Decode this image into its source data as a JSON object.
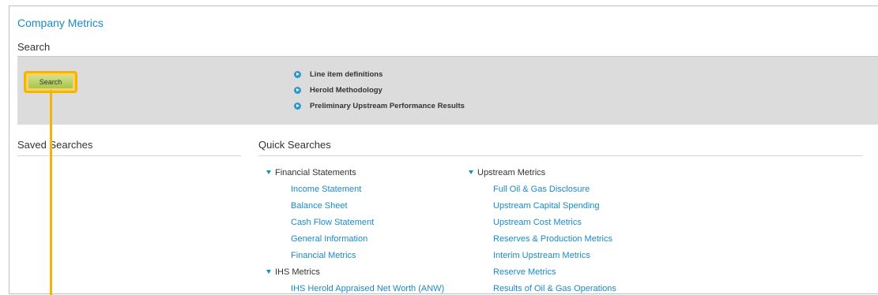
{
  "page": {
    "title": "Company Metrics",
    "search_heading": "Search"
  },
  "search_bar": {
    "button_label": "Search",
    "links": [
      {
        "label": "Line item definitions",
        "icon": "arrow-circle-icon"
      },
      {
        "label": "Herold Methodology",
        "icon": "arrow-circle-icon"
      },
      {
        "label": "Preliminary Upstream Performance Results",
        "icon": "arrow-circle-icon"
      }
    ]
  },
  "saved_searches": {
    "title": "Saved Searches"
  },
  "quick_searches": {
    "title": "Quick Searches",
    "groups": [
      {
        "label": "Financial Statements",
        "items": [
          "Income Statement",
          "Balance Sheet",
          "Cash Flow Statement",
          "General Information",
          "Financial Metrics"
        ]
      },
      {
        "label": "IHS Metrics",
        "items": [
          "IHS Herold Appraised Net Worth (ANW)"
        ]
      },
      {
        "label": "Upstream Metrics",
        "items": [
          "Full Oil & Gas Disclosure",
          "Upstream Capital Spending",
          "Upstream Cost Metrics",
          "Reserves & Production Metrics",
          "Interim Upstream Metrics",
          "Reserve Metrics",
          "Results of Oil & Gas Operations"
        ]
      }
    ]
  },
  "colors": {
    "link": "#1a8ac8",
    "highlight": "#f5b400",
    "band": "#dcdcdc",
    "button": "#a9c44a"
  }
}
